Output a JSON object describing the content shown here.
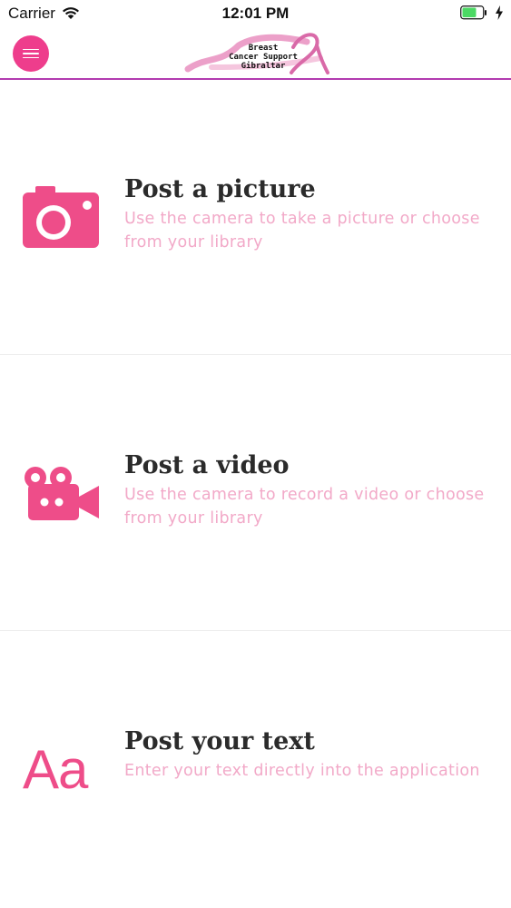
{
  "status_bar": {
    "carrier": "Carrier",
    "time": "12:01 PM",
    "battery_color": "#4cd964"
  },
  "header": {
    "menu_icon": "hamburger-menu-icon",
    "logo": {
      "line1": "Breast",
      "line2": "Cancer Support",
      "line3": "Gibraltar"
    },
    "accent_color": "#ee3d8c",
    "border_color": "#b23bb0"
  },
  "options": [
    {
      "icon": "camera-icon",
      "title": "Post a picture",
      "description": "Use the camera to take a picture or choose from your library"
    },
    {
      "icon": "video-camera-icon",
      "title": "Post a video",
      "description": "Use the camera to record a video or choose from your library"
    },
    {
      "icon": "text-icon",
      "icon_text": "Aa",
      "title": "Post your text",
      "description": "Enter your text directly into the application"
    }
  ],
  "colors": {
    "icon_pink": "#ee4d89",
    "description_pink": "#f2a9c8",
    "title_dark": "#2b2b2b"
  }
}
